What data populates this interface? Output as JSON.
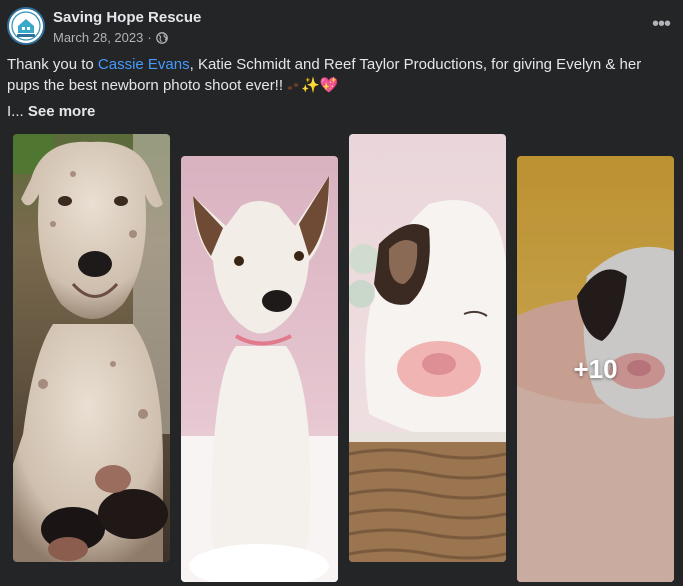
{
  "page": {
    "name": "Saving Hope Rescue",
    "date": "March 28, 2023",
    "separator": "·",
    "avatar_text": "ANIMAL RESCUE",
    "more_label": "•••"
  },
  "post": {
    "text_before": "Thank you to ",
    "mention": "Cassie Evans",
    "text_after": ", Katie Schmidt and Reef Taylor Productions, for giving Evelyn & her pups the best newborn photo shoot ever!! ",
    "emojis": "✨💖",
    "truncated": "I...",
    "see_more": "See more"
  },
  "photos": [
    {
      "subject": "mother dog with newborn pups"
    },
    {
      "subject": "white dog on pink backdrop"
    },
    {
      "subject": "sleeping puppy in basket"
    },
    {
      "subject": "puppy held in hands",
      "overlay": "+10"
    }
  ],
  "colors": {
    "background": "#242526",
    "text": "#e4e6eb",
    "secondary": "#b0b3b8",
    "link": "#4599ff",
    "brand": "#2f6f9a"
  }
}
